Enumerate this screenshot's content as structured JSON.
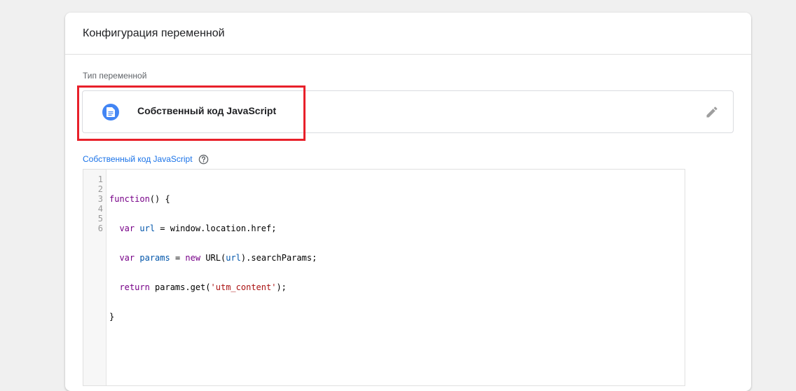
{
  "header": {
    "title": "Конфигурация переменной"
  },
  "variable_type": {
    "section_label": "Тип переменной",
    "selected_type": "Собственный код JavaScript",
    "icon": "document-icon",
    "edit_icon": "pencil-icon",
    "highlight_color": "#e8202a",
    "icon_color": "#4285f4"
  },
  "code_editor": {
    "label": "Собственный код JavaScript",
    "help_icon": "help-circle-icon",
    "line_numbers": [
      "1",
      "2",
      "3",
      "4",
      "5",
      "6"
    ],
    "lines": [
      "function() {",
      "  var url = window.location.href;",
      "  var params = new URL(url).searchParams;",
      "  return params.get('utm_content');",
      "}",
      ""
    ]
  }
}
